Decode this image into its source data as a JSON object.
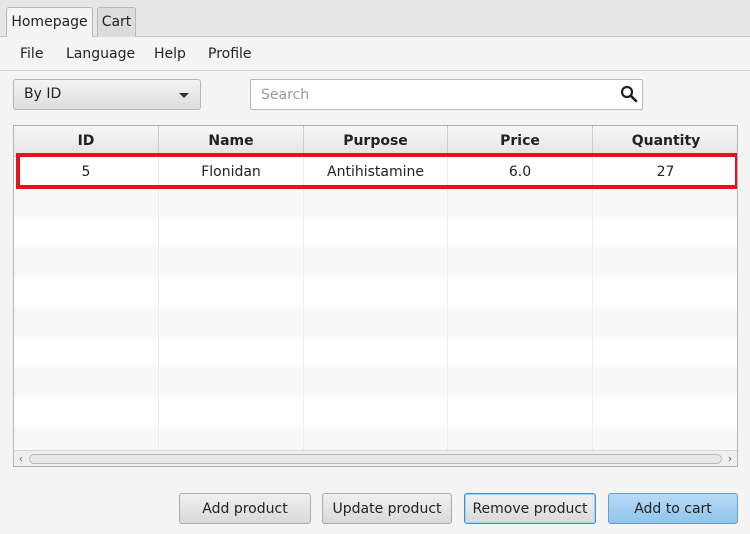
{
  "tabs": [
    {
      "label": "Homepage",
      "active": true
    },
    {
      "label": "Cart",
      "active": false
    }
  ],
  "menu": [
    "File",
    "Language",
    "Help",
    "Profile"
  ],
  "filter": {
    "selected": "By ID"
  },
  "search": {
    "placeholder": "Search",
    "value": ""
  },
  "table": {
    "columns": [
      "ID",
      "Name",
      "Purpose",
      "Price",
      "Quantity"
    ],
    "rows": [
      {
        "id": "5",
        "name": "Flonidan",
        "purpose": "Antihistamine",
        "price": "6.0",
        "quantity": "27"
      }
    ],
    "highlight_color": "#e4141f"
  },
  "buttons": {
    "add_product": "Add product",
    "update_product": "Update product",
    "remove_product": "Remove product",
    "add_to_cart": "Add to cart"
  },
  "icons": {
    "search": "search-icon",
    "dropdown": "chevron-down-icon",
    "scroll_left": "arrow-left-icon",
    "scroll_right": "arrow-right-icon"
  },
  "colors": {
    "accent": "#8fc4ec",
    "focus": "#3c8fd2"
  }
}
